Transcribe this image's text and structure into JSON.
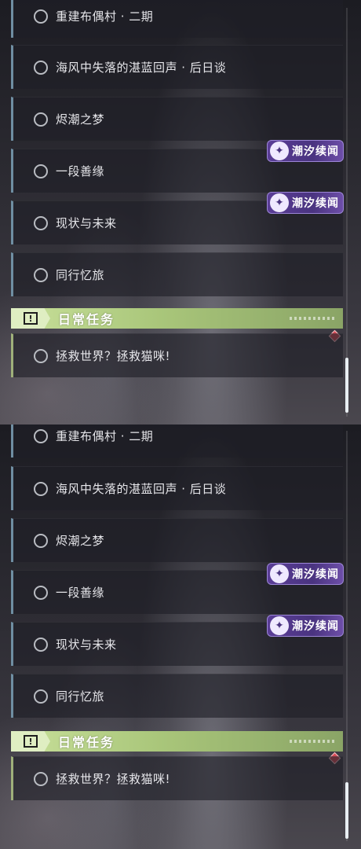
{
  "quests": [
    {
      "label": "重建布偶村 · 二期"
    },
    {
      "label": "海风中失落的湛蓝回声 · 后日谈"
    },
    {
      "label": "烬潮之梦"
    },
    {
      "label": "一段善缘"
    },
    {
      "label": "现状与未来"
    },
    {
      "label": "同行忆旅"
    }
  ],
  "badge": {
    "label": "潮汐续闻",
    "icon": "tide-icon"
  },
  "daily_section": {
    "title": "日常任务",
    "icon": "exclamation-icon",
    "accent_color": "#a9c67a"
  },
  "daily_quests": [
    {
      "label": "拯救世界？拯救猫咪!"
    }
  ],
  "colors": {
    "badge": "#5a3d96",
    "item_border": "#6f8ea2",
    "alert": "#d94a55"
  }
}
